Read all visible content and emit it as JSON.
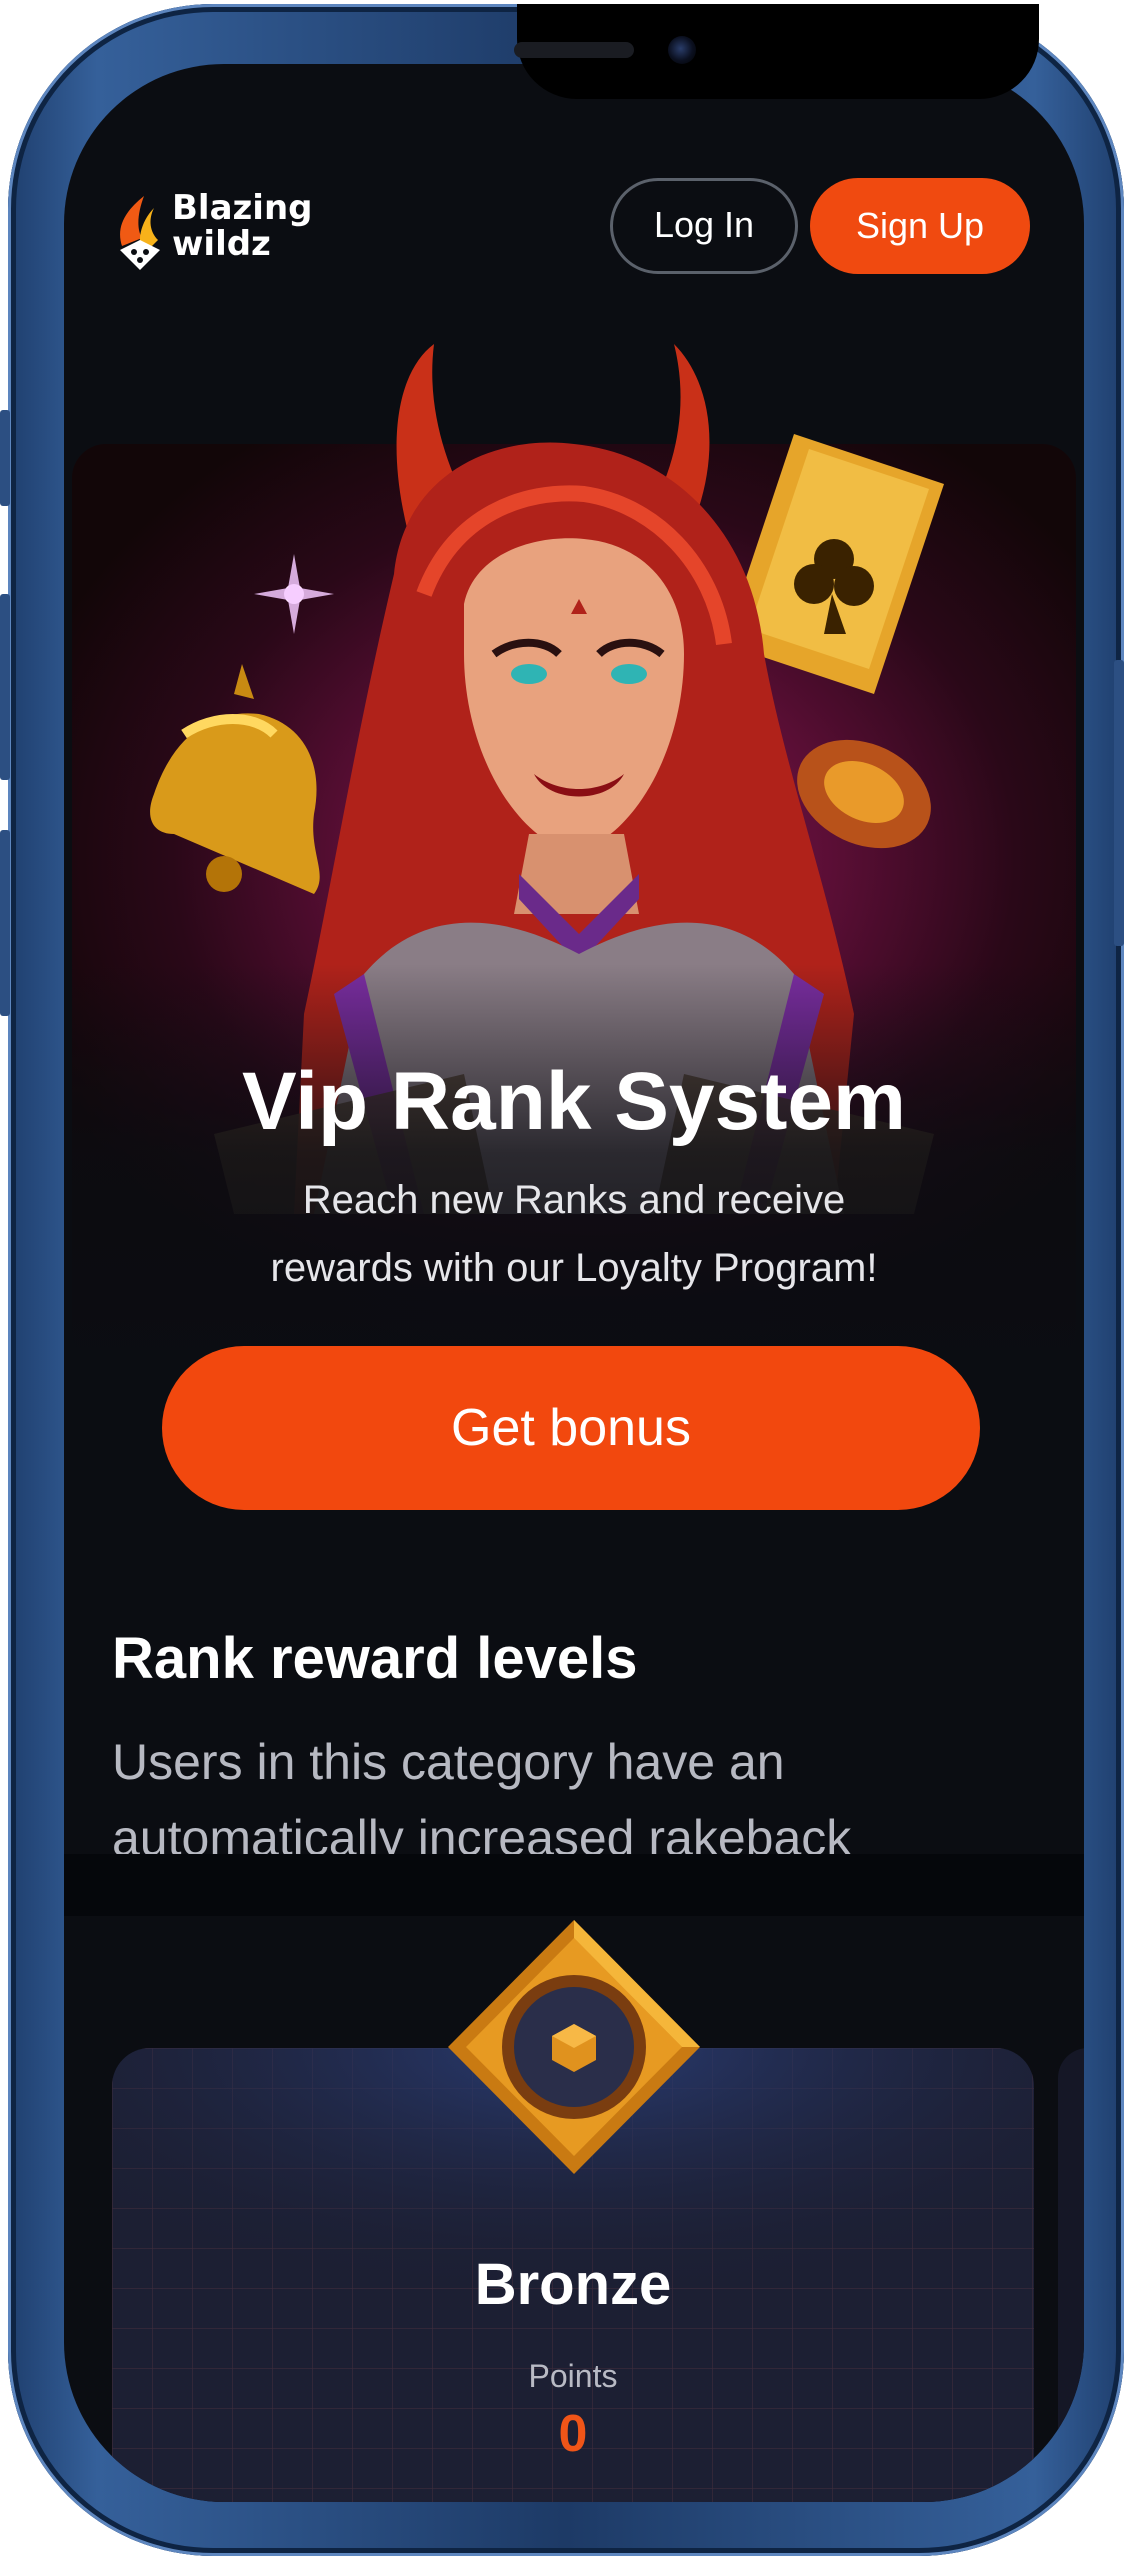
{
  "header": {
    "logo_line1": "Blazing",
    "logo_line2": "wildz",
    "login_label": "Log In",
    "signup_label": "Sign Up"
  },
  "hero": {
    "title": "Vip Rank System",
    "subtitle_line1": "Reach new Ranks and receive",
    "subtitle_line2": "rewards with our Loyalty Program!",
    "cta_label": "Get bonus"
  },
  "rank_section": {
    "title": "Rank reward levels",
    "desc_line1": "Users in this category have an",
    "desc_line2": "automatically increased rakeback"
  },
  "tier": {
    "name": "Bronze",
    "points_label": "Points",
    "points_value": "0"
  },
  "colors": {
    "accent": "#f2480e",
    "background": "#0b0d12",
    "card": "#1c1f33",
    "frame": "#2c4f82"
  },
  "icons": {
    "logo": "flame-dice-icon",
    "badge": "bronze-diamond-badge-icon"
  }
}
